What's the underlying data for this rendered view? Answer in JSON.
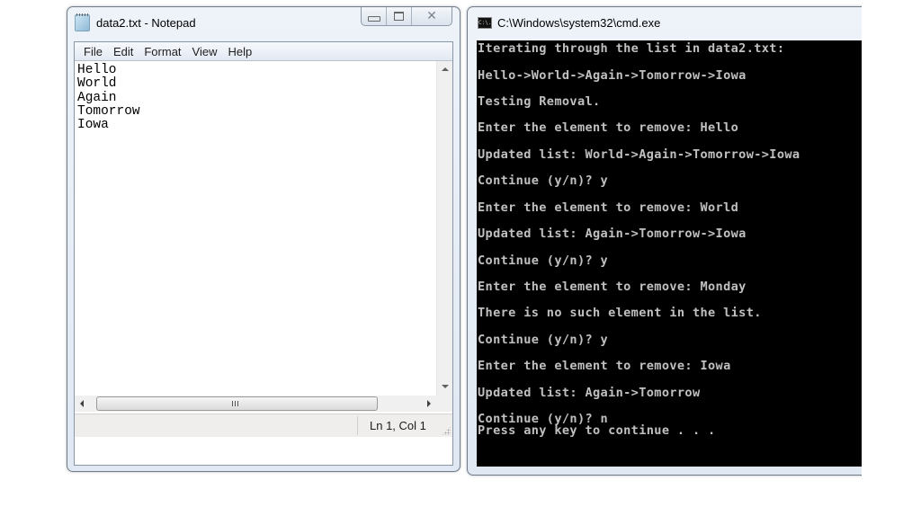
{
  "notepad": {
    "title": "data2.txt - Notepad",
    "icon": "notepad-icon",
    "window_buttons": {
      "minimize": "minimize",
      "maximize": "maximize",
      "close": "close"
    },
    "menu": [
      "File",
      "Edit",
      "Format",
      "View",
      "Help"
    ],
    "content_lines": [
      "Hello",
      "World",
      "Again",
      "Tomorrow",
      "Iowa"
    ],
    "status": {
      "position": "Ln 1, Col 1"
    }
  },
  "cmd": {
    "title": "C:\\Windows\\system32\\cmd.exe",
    "icon": "cmd-icon",
    "icon_text": "C:\\.",
    "lines": [
      "Iterating through the list in data2.txt:",
      "Hello->World->Again->Tomorrow->Iowa",
      "Testing Removal.",
      "Enter the element to remove: Hello",
      "Updated list: World->Again->Tomorrow->Iowa",
      "Continue (y/n)? y",
      "Enter the element to remove: World",
      "Updated list: Again->Tomorrow->Iowa",
      "Continue (y/n)? y",
      "Enter the element to remove: Monday",
      "There is no such element in the list.",
      "Continue (y/n)? y",
      "Enter the element to remove: Iowa",
      "Updated list: Again->Tomorrow",
      "Continue (y/n)? n",
      "Press any key to continue . . ."
    ]
  }
}
